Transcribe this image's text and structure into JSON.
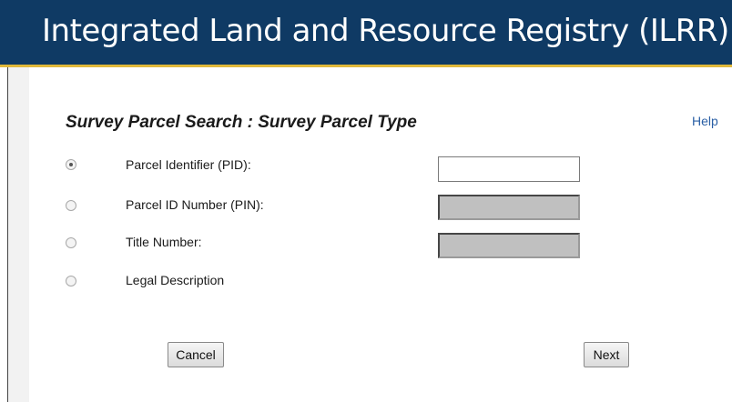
{
  "header": {
    "title": "Integrated Land and Resource Registry (ILRR)"
  },
  "search": {
    "title": "Survey Parcel Search :  Survey Parcel Type",
    "help_label": "Help",
    "options": [
      {
        "label": "Parcel Identifier (PID):",
        "selected": true,
        "field_value": "",
        "field_enabled": true
      },
      {
        "label": "Parcel ID Number (PIN):",
        "selected": false,
        "field_value": "",
        "field_enabled": false
      },
      {
        "label": "Title Number:",
        "selected": false,
        "field_value": "",
        "field_enabled": false
      },
      {
        "label": "Legal Description",
        "selected": false
      }
    ]
  },
  "buttons": {
    "cancel_label": "Cancel",
    "next_label": "Next"
  },
  "colors": {
    "header_bg": "#0f3a64",
    "header_accent": "#e0b83a",
    "link": "#2a5fa5"
  }
}
